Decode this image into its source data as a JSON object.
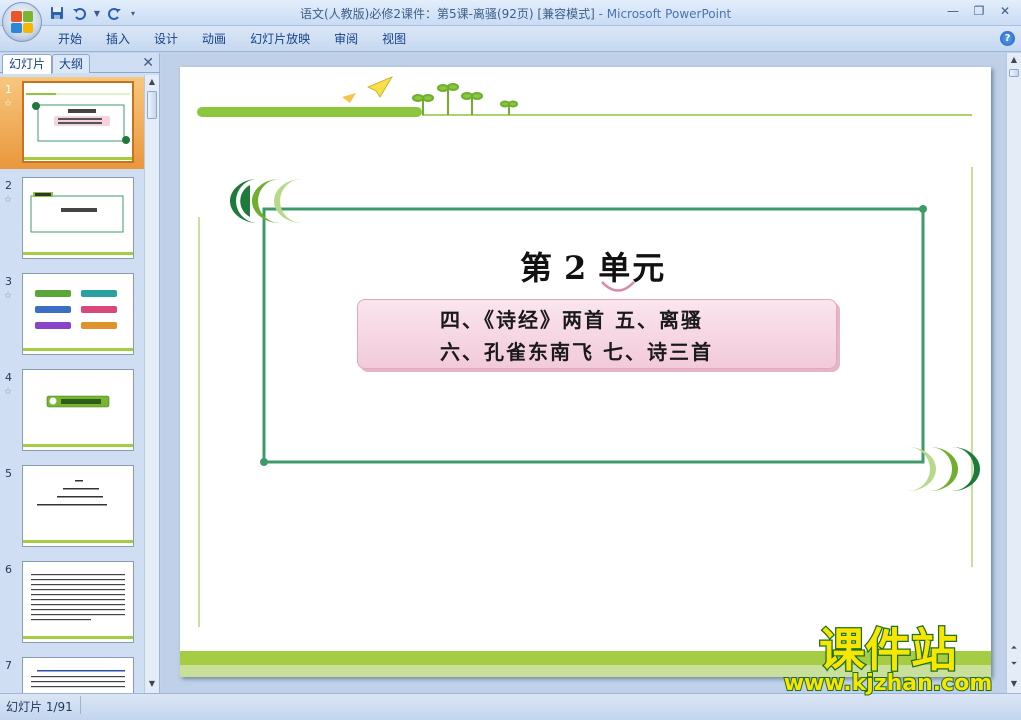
{
  "window": {
    "title_doc": "语文(人教版)必修2课件：第5课-离骚(92页) [兼容模式]",
    "title_sep": " - ",
    "title_app": "Microsoft PowerPoint",
    "controls": {
      "minimize": "—",
      "restore": "❐",
      "close": "✕"
    }
  },
  "quick_access": {
    "save_icon": "save-icon",
    "undo_icon": "undo-icon",
    "redo_icon": "repeat-icon"
  },
  "ribbon": {
    "tabs": [
      {
        "label": "开始"
      },
      {
        "label": "插入"
      },
      {
        "label": "设计"
      },
      {
        "label": "动画"
      },
      {
        "label": "幻灯片放映"
      },
      {
        "label": "审阅"
      },
      {
        "label": "视图"
      }
    ],
    "help": "?"
  },
  "left_pane": {
    "tabs": [
      {
        "label": "幻灯片"
      },
      {
        "label": "大纲"
      }
    ],
    "close": "✕",
    "thumbnails": [
      {
        "number": "1",
        "star": "☆"
      },
      {
        "number": "2",
        "star": "☆"
      },
      {
        "number": "3",
        "star": "☆"
      },
      {
        "number": "4",
        "star": "☆"
      },
      {
        "number": "5"
      },
      {
        "number": "6"
      },
      {
        "number": "7"
      }
    ],
    "selected_index": 0
  },
  "slide": {
    "unit_prefix": "第",
    "unit_number": "2",
    "unit_suffix": "单元",
    "lesson_line_1": "四、《诗经》两首  五、离骚",
    "lesson_line_2": "六、孔雀东南飞  七、诗三首"
  },
  "status": {
    "slide_counter": "幻灯片 1/91"
  },
  "watermark": {
    "brand": "课件站",
    "url": "www.kjzhan.com"
  },
  "colors": {
    "slide_green": "#3f9a6a",
    "accent_green": "#8cc63f",
    "pink_box": "#f5d3df",
    "selected_thumb": "#e9973c"
  }
}
